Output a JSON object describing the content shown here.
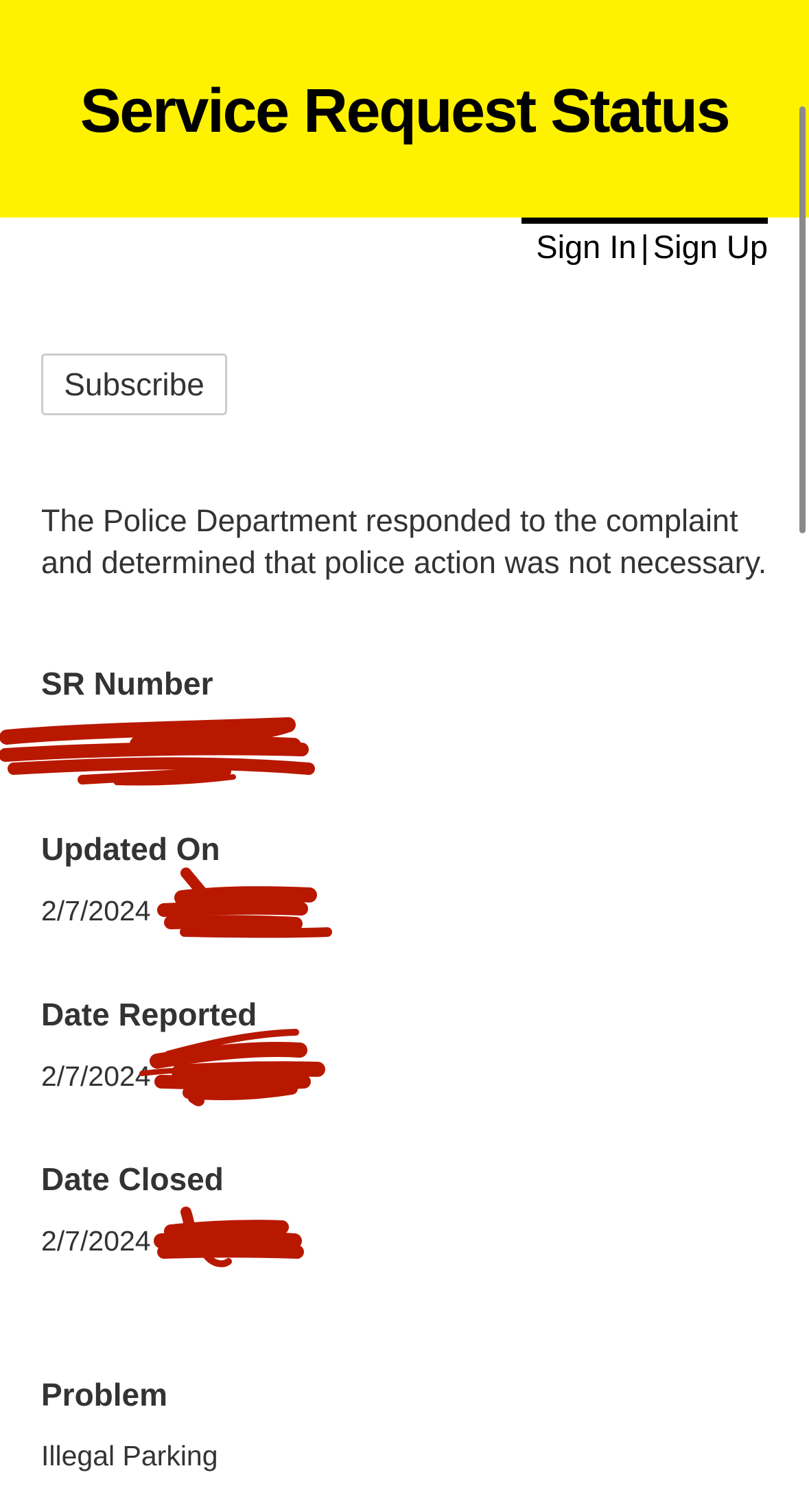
{
  "header": {
    "title": "Service Request Status",
    "background_color": "#fff200"
  },
  "auth": {
    "sign_in": "Sign In",
    "separator": "|",
    "sign_up": "Sign Up"
  },
  "actions": {
    "subscribe_label": "Subscribe"
  },
  "status": {
    "message": "The Police Department responded to the complaint and determined that police action was not necessary."
  },
  "fields": {
    "sr_number": {
      "label": "SR Number",
      "value": ""
    },
    "updated_on": {
      "label": "Updated On",
      "value": "2/7/2024"
    },
    "date_reported": {
      "label": "Date Reported",
      "value": "2/7/2024"
    },
    "date_closed": {
      "label": "Date Closed",
      "value": "2/7/2024"
    },
    "problem": {
      "label": "Problem",
      "value": "Illegal Parking"
    }
  },
  "redaction_color": "#b81800"
}
